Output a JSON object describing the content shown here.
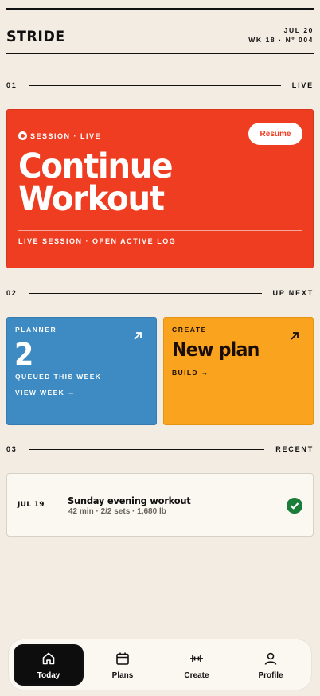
{
  "header": {
    "brand": "STRIDE",
    "date": "JUL 20",
    "week": "WK 18 · Nº 004"
  },
  "sections": [
    {
      "number": "01",
      "label": "LIVE"
    },
    {
      "number": "02",
      "label": "UP NEXT"
    },
    {
      "number": "03",
      "label": "RECENT"
    }
  ],
  "hero": {
    "tag": "SESSION · LIVE",
    "resume_label": "Resume",
    "title_line1": "Continue",
    "title_line2": "Workout",
    "footer": "LIVE SESSION · OPEN ACTIVE LOG"
  },
  "planner": {
    "label": "PLANNER",
    "count": "2",
    "subtitle": "QUEUED THIS WEEK",
    "link": "VIEW WEEK →"
  },
  "create": {
    "label": "CREATE",
    "title": "New plan",
    "link": "BUILD →"
  },
  "recent": {
    "date": "JUL 19",
    "title": "Sunday evening workout",
    "meta": "42 min · 2/2 sets · 1,680 lb",
    "status": "completed"
  },
  "tabs": [
    {
      "label": "Today",
      "icon": "home-icon",
      "active": true
    },
    {
      "label": "Plans",
      "icon": "calendar-icon",
      "active": false
    },
    {
      "label": "Create",
      "icon": "dumbbell-icon",
      "active": false
    },
    {
      "label": "Profile",
      "icon": "user-icon",
      "active": false
    }
  ],
  "colors": {
    "background": "#f2ece2",
    "hero_red": "#ef3d22",
    "planner_blue": "#3d8bc2",
    "create_orange": "#f9a31f",
    "success_green": "#1b7d3a"
  }
}
